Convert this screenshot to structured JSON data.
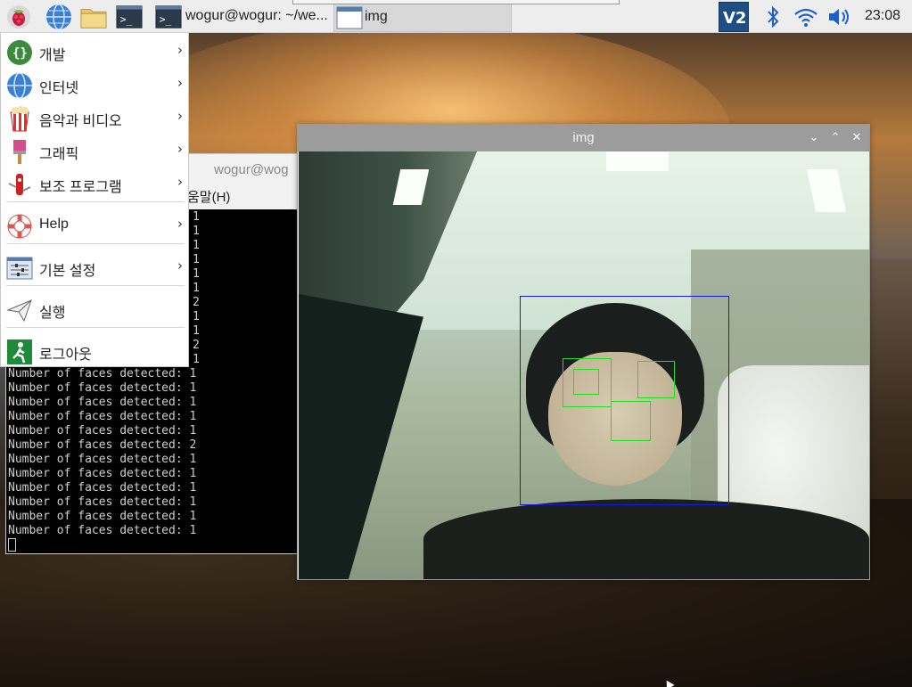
{
  "taskbar": {
    "task_terminal_label": "wogur@wogur: ~/we...",
    "task_img_label": "img",
    "clock": "23:08",
    "icons": [
      "raspberry-icon",
      "browser-globe-icon",
      "file-manager-folder-icon",
      "terminal-icon",
      "terminal-icon",
      "vnc-icon",
      "bluetooth-icon",
      "wifi-icon",
      "volume-icon"
    ]
  },
  "menu": {
    "items": [
      {
        "label": "개발",
        "icon": "programming-braces-icon",
        "submenu": true
      },
      {
        "label": "인터넷",
        "icon": "internet-globe-icon",
        "submenu": true
      },
      {
        "label": "음악과 비디오",
        "icon": "sound-video-popcorn-icon",
        "submenu": true
      },
      {
        "label": "그래픽",
        "icon": "graphics-brush-icon",
        "submenu": true
      },
      {
        "label": "보조 프로그램",
        "icon": "accessories-knife-icon",
        "submenu": true
      },
      {
        "label": "Help",
        "icon": "help-lifebuoy-icon",
        "submenu": true
      },
      {
        "label": "기본 설정",
        "icon": "preferences-sliders-icon",
        "submenu": true
      },
      {
        "label": "실행",
        "icon": "run-paper-plane-icon",
        "submenu": false
      },
      {
        "label": "로그아웃",
        "icon": "logout-exit-icon",
        "submenu": false
      }
    ]
  },
  "terminal": {
    "title": "wogur@wog",
    "menubar_item": "움말(H)",
    "partial_values": [
      "1",
      "1",
      "1",
      "1",
      "1",
      "1",
      "2",
      "1",
      "1",
      "2",
      "1"
    ],
    "lines": [
      "Number of faces detected: 1",
      "Number of faces detected: 1",
      "Number of faces detected: 1",
      "Number of faces detected: 1",
      "Number of faces detected: 1",
      "Number of faces detected: 2",
      "Number of faces detected: 1",
      "Number of faces detected: 1",
      "Number of faces detected: 1",
      "Number of faces detected: 1",
      "Number of faces detected: 1",
      "Number of faces detected: 1"
    ]
  },
  "img_window": {
    "title": "img",
    "face_box_color": "#1a1ad6",
    "feature_box_color": "#22dd22"
  },
  "colors": {
    "taskbar_bg": "#ededed",
    "menu_bg": "#ffffff",
    "terminal_bg": "#000000",
    "terminal_text": "#cfcfcf",
    "titlebar": "#9c9c9c"
  }
}
